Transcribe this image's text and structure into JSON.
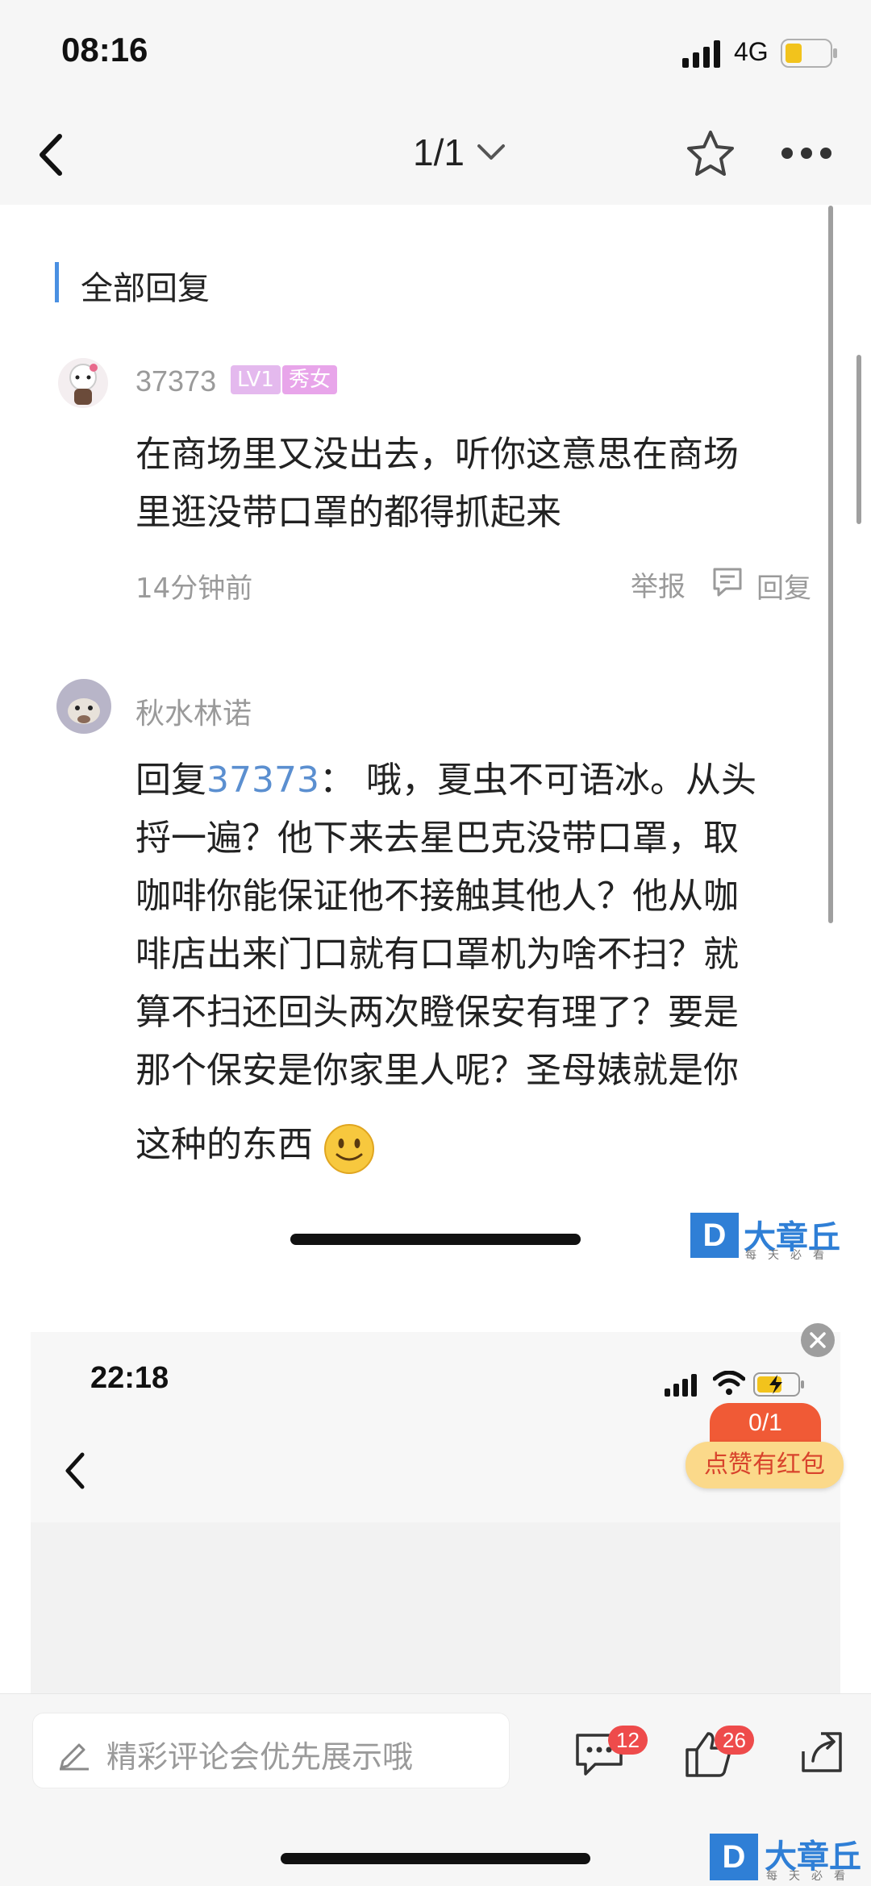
{
  "status_bar": {
    "time": "08:16",
    "network": "4G"
  },
  "nav": {
    "page_indicator": "1/1"
  },
  "section": {
    "title": "全部回复"
  },
  "comment1": {
    "username": "37373",
    "level_badge": "LV1",
    "tag_badge": "秀女",
    "text_line1": "在商场里又没出去，听你这意思在商场",
    "text_line2": "里逛没带口罩的都得抓起来",
    "time": "14分钟前",
    "report_label": "举报",
    "reply_label": "回复"
  },
  "comment2": {
    "username": "秋水林诺",
    "reply_prefix": "回复",
    "reply_target": "37373",
    "line1_rest": "：  哦，夏虫不可语冰。从头",
    "line2": "捋一遍？他下来去星巴克没带口罩，取",
    "line3": "咖啡你能保证他不接触其他人？他从咖",
    "line4": "啡店出来门口就有口罩机为啥不扫？就",
    "line5": "算不扫还回头两次瞪保安有理了？要是",
    "line6": "那个保安是你家里人呢？圣母婊就是你",
    "line7": "这种的东西"
  },
  "embedded": {
    "time": "22:18",
    "vote_count": "0/1",
    "vote_label": "点赞有红包"
  },
  "bottom": {
    "comment_placeholder": "精彩评论会优先展示哦",
    "comment_count": "12",
    "like_count": "26"
  },
  "watermark": {
    "name": "大章丘",
    "sub": "每天必看",
    "logo_letter": "D"
  },
  "colors": {
    "accent": "#4a90e2",
    "link": "#5b8fd0",
    "badge_red": "#ee4b4b"
  }
}
